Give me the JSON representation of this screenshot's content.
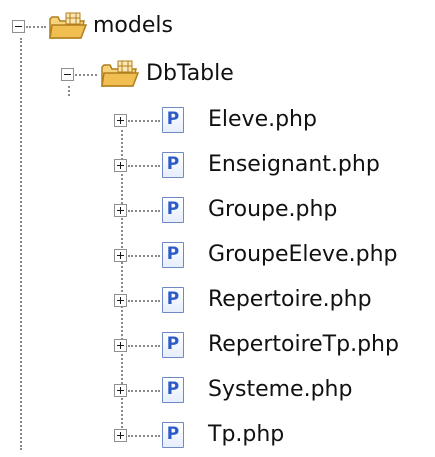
{
  "tree": {
    "root": {
      "label": "models",
      "expanded": true,
      "icon": "package-folder-icon"
    },
    "child": {
      "label": "DbTable",
      "expanded": true,
      "icon": "package-folder-icon"
    },
    "files": [
      {
        "label": "Eleve.php",
        "icon": "php-file-icon",
        "expanded": false
      },
      {
        "label": "Enseignant.php",
        "icon": "php-file-icon",
        "expanded": false
      },
      {
        "label": "Groupe.php",
        "icon": "php-file-icon",
        "expanded": false
      },
      {
        "label": "GroupeEleve.php",
        "icon": "php-file-icon",
        "expanded": false
      },
      {
        "label": "Repertoire.php",
        "icon": "php-file-icon",
        "expanded": false
      },
      {
        "label": "RepertoireTp.php",
        "icon": "php-file-icon",
        "expanded": false
      },
      {
        "label": "Systeme.php",
        "icon": "php-file-icon",
        "expanded": false
      },
      {
        "label": "Tp.php",
        "icon": "php-file-icon",
        "expanded": false
      }
    ],
    "file_icon_letter": "P",
    "colors": {
      "folder": "#e8b84a",
      "file_icon_accent": "#2c5bc8",
      "connector": "#8a8a8a"
    }
  }
}
